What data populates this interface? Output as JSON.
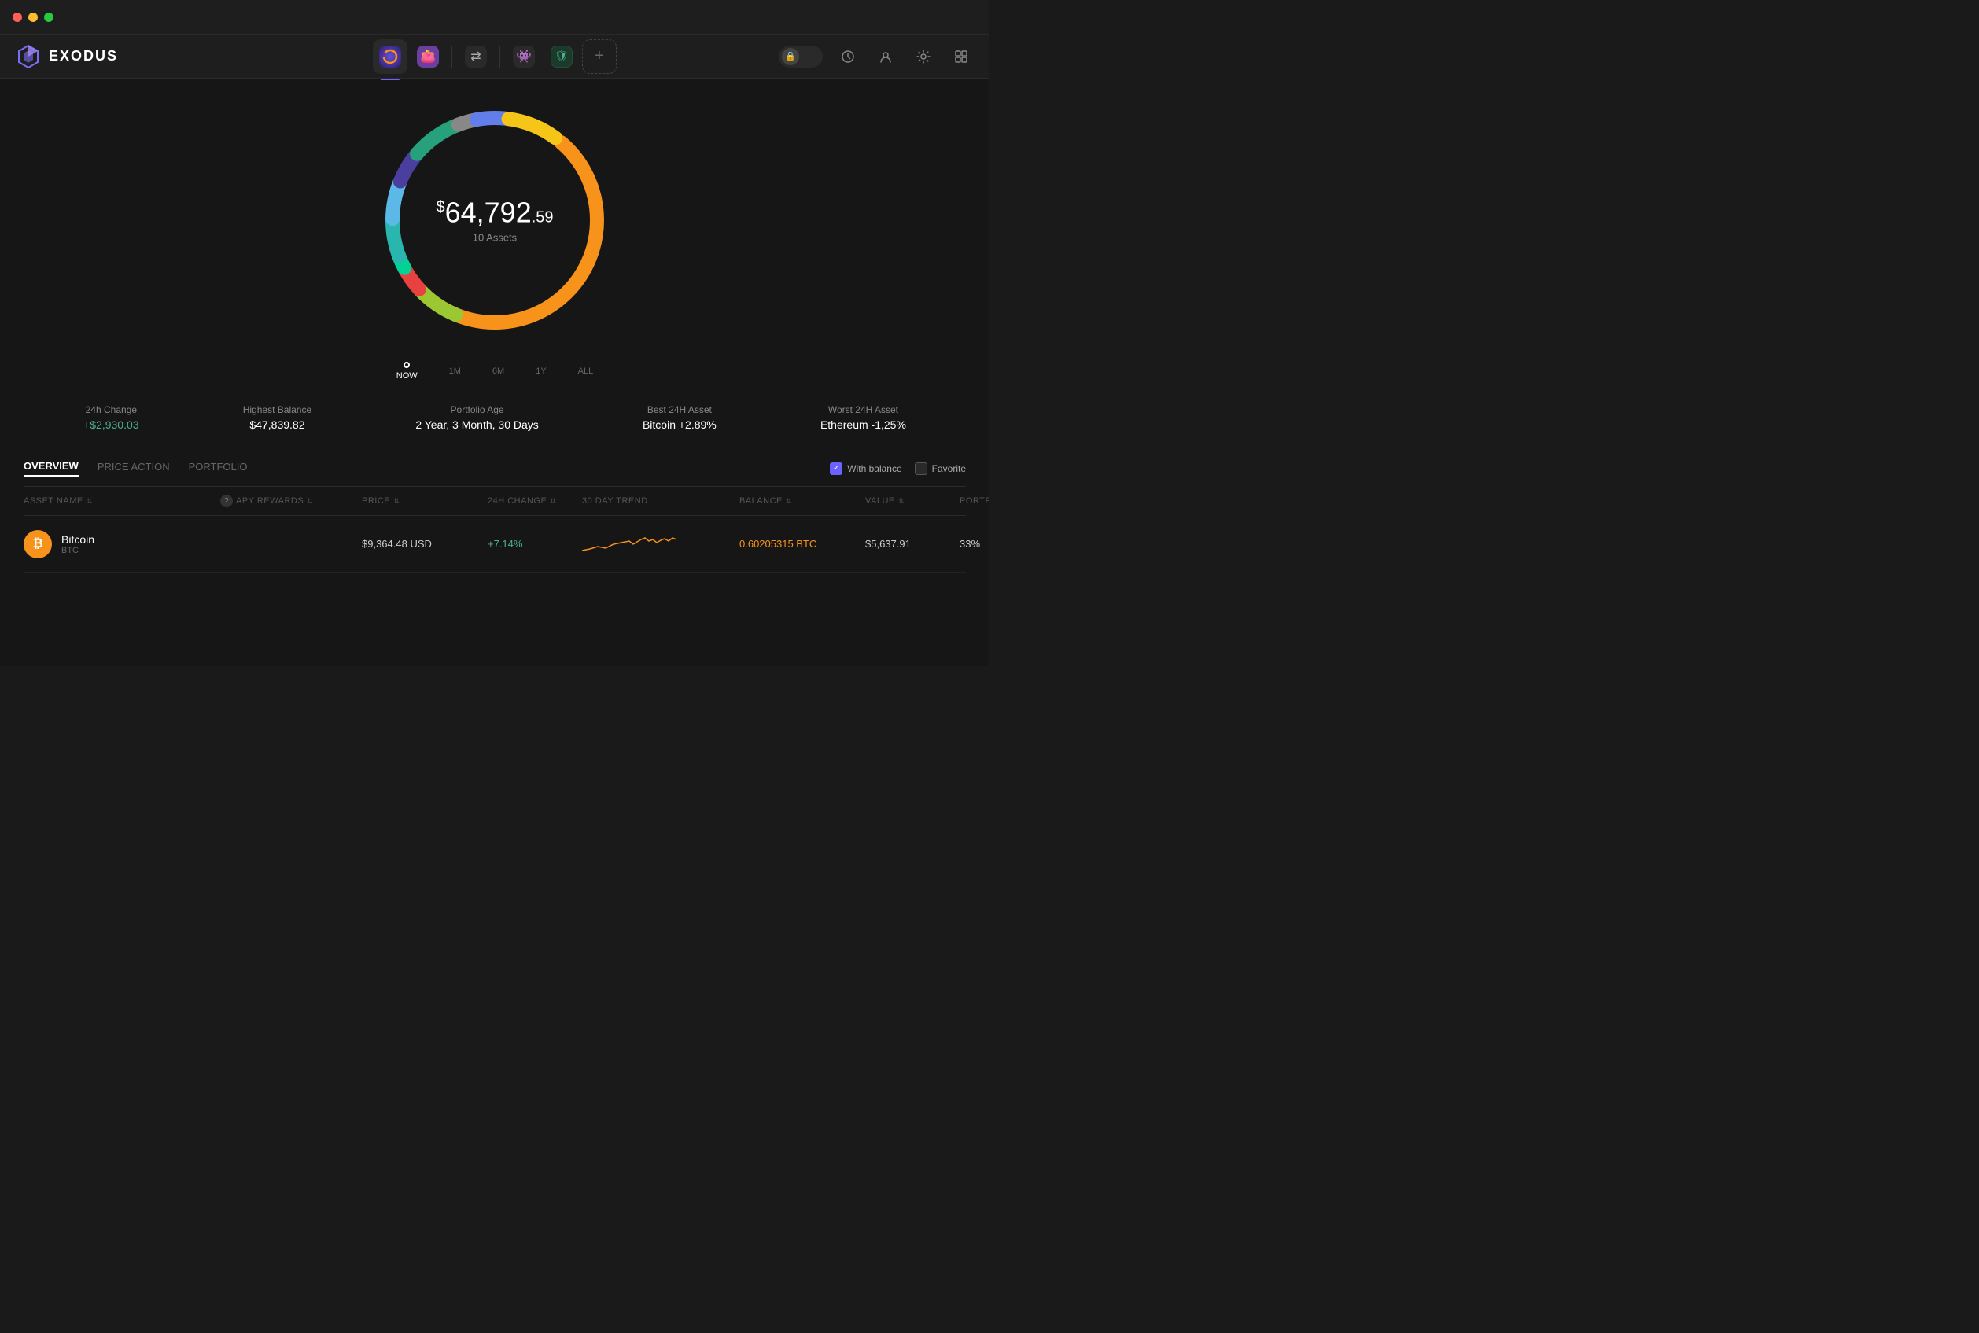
{
  "titlebar": {
    "traffic_lights": [
      "red",
      "yellow",
      "green"
    ]
  },
  "header": {
    "logo_text": "EXODUS",
    "nav_tabs": [
      {
        "id": "portfolio",
        "icon": "🟡",
        "active": true,
        "label": "Portfolio"
      },
      {
        "id": "wallet",
        "icon": "🟪",
        "active": false,
        "label": "Wallet"
      },
      {
        "id": "exchange",
        "icon": "⇄",
        "active": false,
        "label": "Exchange"
      },
      {
        "id": "nft",
        "icon": "👾",
        "active": false,
        "label": "NFT"
      },
      {
        "id": "web3",
        "icon": "🛡",
        "active": false,
        "label": "Web3"
      },
      {
        "id": "add",
        "icon": "+",
        "active": false,
        "label": "Add"
      }
    ],
    "right_icons": [
      "lock",
      "history",
      "profile",
      "settings",
      "grid"
    ]
  },
  "portfolio": {
    "total_amount_main": "64,792",
    "total_amount_cents": ".59",
    "total_amount_prefix": "$",
    "asset_count": "10 Assets",
    "timeline": [
      {
        "label": "NOW",
        "active": true
      },
      {
        "label": "1M",
        "active": false
      },
      {
        "label": "6M",
        "active": false
      },
      {
        "label": "1Y",
        "active": false
      },
      {
        "label": "ALL",
        "active": false
      }
    ],
    "stats": [
      {
        "label": "24h Change",
        "value": "+$2,930.03",
        "positive": true
      },
      {
        "label": "Highest Balance",
        "value": "$47,839.82",
        "positive": false
      },
      {
        "label": "Portfolio Age",
        "value": "2 Year, 3 Month, 30 Days",
        "positive": false
      },
      {
        "label": "Best 24H Asset",
        "value": "Bitcoin +2.89%",
        "positive": false
      },
      {
        "label": "Worst 24H Asset",
        "value": "Ethereum -1,25%",
        "positive": false
      }
    ],
    "donut_segments": [
      {
        "color": "#f7931a",
        "percent": 45,
        "label": "Bitcoin"
      },
      {
        "color": "#f5c518",
        "percent": 8,
        "label": "Yellow"
      },
      {
        "color": "#e84142",
        "percent": 4,
        "label": "Red"
      },
      {
        "color": "#00d395",
        "percent": 3,
        "label": "Teal small"
      },
      {
        "color": "#29b6af",
        "percent": 6,
        "label": "Cyan"
      },
      {
        "color": "#627eea",
        "percent": 5,
        "label": "Purple"
      },
      {
        "color": "#26a17b",
        "percent": 8,
        "label": "Green light"
      },
      {
        "color": "#9bc832",
        "percent": 7,
        "label": "Yellow-green"
      },
      {
        "color": "#aaa",
        "percent": 3,
        "label": "Gray"
      },
      {
        "color": "#5cb8e6",
        "percent": 6,
        "label": "Blue"
      },
      {
        "color": "#4a3f9f",
        "percent": 5,
        "label": "Indigo"
      }
    ]
  },
  "table": {
    "tabs": [
      {
        "label": "OVERVIEW",
        "active": true
      },
      {
        "label": "PRICE ACTION",
        "active": false
      },
      {
        "label": "PORTFOLIO",
        "active": false
      }
    ],
    "filters": [
      {
        "label": "With balance",
        "checked": true
      },
      {
        "label": "Favorite",
        "checked": false
      }
    ],
    "columns": [
      {
        "label": "ASSET NAME",
        "sortable": true
      },
      {
        "label": "APY REWARDS",
        "sortable": true,
        "help": true
      },
      {
        "label": "PRICE",
        "sortable": true
      },
      {
        "label": "24H CHANGE",
        "sortable": true
      },
      {
        "label": "30 DAY TREND",
        "sortable": false
      },
      {
        "label": "BALANCE",
        "sortable": true
      },
      {
        "label": "VALUE",
        "sortable": true
      },
      {
        "label": "PORTFOLIO %",
        "sortable": true
      }
    ],
    "rows": [
      {
        "name": "Bitcoin",
        "symbol": "BTC",
        "icon_color": "#f7931a",
        "icon_letter": "₿",
        "apy": "",
        "price": "$9,364.48 USD",
        "change": "+7.14%",
        "change_positive": true,
        "balance": "0.60205315 BTC",
        "balance_orange": true,
        "value": "$5,637.91",
        "portfolio": "33%"
      }
    ]
  }
}
